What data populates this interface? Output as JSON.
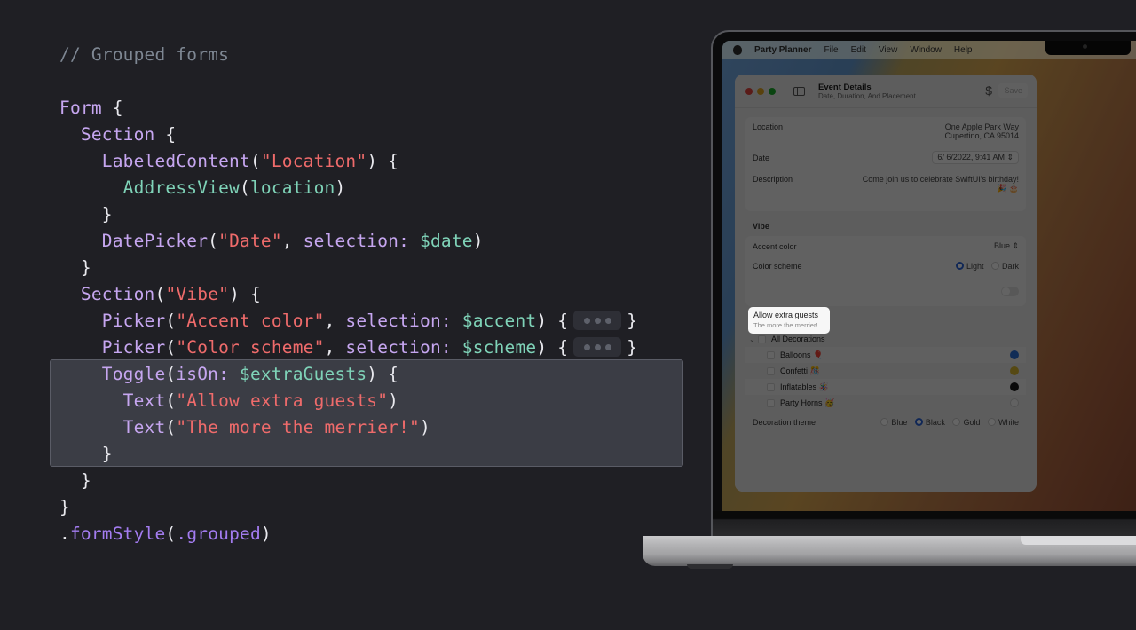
{
  "code": {
    "comment": "// Grouped forms",
    "lines": {
      "form_kw": "Form",
      "section_kw": "Section",
      "labeled_content": "LabeledContent",
      "location_str": "\"Location\"",
      "address_view": "AddressView",
      "location_var": "location",
      "date_picker": "DatePicker",
      "date_str": "\"Date\"",
      "selection_label": "selection:",
      "date_var": "$date",
      "vibe_str": "\"Vibe\"",
      "picker": "Picker",
      "accent_str": "\"Accent color\"",
      "accent_var": "$accent",
      "scheme_str": "\"Color scheme\"",
      "scheme_var": "$scheme",
      "toggle": "Toggle",
      "is_on_label": "isOn:",
      "extra_guests_var": "$extraGuests",
      "text": "Text",
      "allow_str": "\"Allow extra guests\"",
      "merrier_str": "\"The more the merrier!\"",
      "form_style": "formStyle",
      "grouped": ".grouped"
    }
  },
  "laptop": {
    "menubar": {
      "app_name": "Party Planner",
      "items": [
        "File",
        "Edit",
        "View",
        "Window",
        "Help"
      ]
    },
    "window": {
      "title": "Event Details",
      "subtitle": "Date, Duration, And Placement",
      "dollar_icon": "$",
      "save_label": "Save",
      "location_label": "Location",
      "location_line1": "One Apple Park Way",
      "location_line2": "Cupertino, CA 95014",
      "date_label": "Date",
      "date_value": "6/  6/2022,  9:41 AM",
      "description_label": "Description",
      "description_value": "Come join us to celebrate SwiftUI's birthday!",
      "description_emoji": "🎉 🎂",
      "vibe_title": "Vibe",
      "accent_label": "Accent color",
      "accent_value": "Blue",
      "scheme_label": "Color scheme",
      "scheme_options": [
        "Light",
        "Dark"
      ],
      "scheme_selected": "Light",
      "toggle_title": "Allow extra guests",
      "toggle_subtitle": "The more the merrier!",
      "toggle_on": false,
      "decorations_title": "Decorations",
      "all_decorations": "All Decorations",
      "decorations": [
        {
          "name": "Balloons 🎈",
          "color": "#2a6fd6"
        },
        {
          "name": "Confetti 🎊",
          "color": "#d8b730"
        },
        {
          "name": "Inflatables 🪅",
          "color": "#1a1a1a"
        },
        {
          "name": "Party Horns 🥳",
          "color": "#f4f4f4"
        }
      ],
      "theme_label": "Decoration theme",
      "theme_options": [
        "Blue",
        "Black",
        "Gold",
        "White"
      ],
      "theme_selected": "Black"
    }
  }
}
